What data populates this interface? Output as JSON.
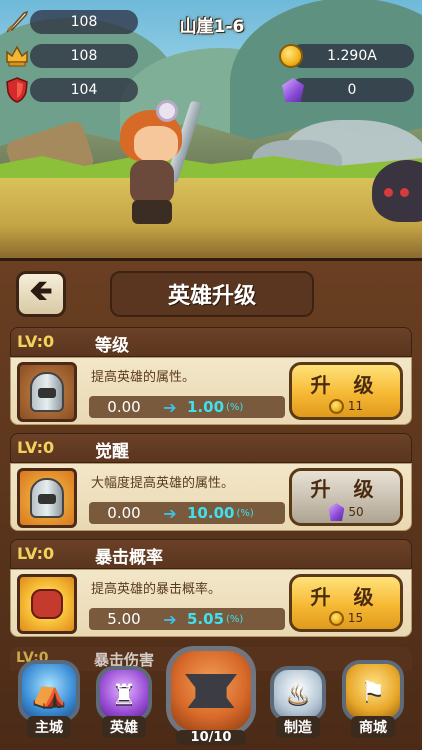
{
  "hud": {
    "stage": "山崖1-6",
    "attack": "108",
    "helmet": "108",
    "defense": "104",
    "gold": "1.290A",
    "gems": "0"
  },
  "panel": {
    "title": "英雄升级",
    "back_icon": "back-arrow-icon"
  },
  "rows": [
    {
      "lv": "LV:0",
      "title": "等级",
      "desc": "提高英雄的属性。",
      "from": "0.00",
      "to": "1.00",
      "unit": "(%)",
      "button": "升 级",
      "cost": "11",
      "currency": "gold"
    },
    {
      "lv": "LV:0",
      "title": "觉醒",
      "desc": "大幅度提高英雄的属性。",
      "from": "0.00",
      "to": "10.00",
      "unit": "(%)",
      "button": "升 级",
      "cost": "50",
      "currency": "gem"
    },
    {
      "lv": "LV:0",
      "title": "暴击概率",
      "desc": "提高英雄的暴击概率。",
      "from": "5.00",
      "to": "5.05",
      "unit": "(%)",
      "button": "升 级",
      "cost": "15",
      "currency": "gold"
    }
  ],
  "peek": {
    "lv": "LV:0",
    "title": "暴击伤害"
  },
  "nav": {
    "items": [
      {
        "label": "主城",
        "icon": "castle-tent-icon"
      },
      {
        "label": "英雄",
        "icon": "hero-icon"
      },
      {
        "label": "10/10",
        "icon": "anvil-icon"
      },
      {
        "label": "制造",
        "icon": "cauldron-icon"
      },
      {
        "label": "商城",
        "icon": "shop-icon"
      }
    ]
  },
  "colors": {
    "gold_button": "#f6b934",
    "gray_button": "#c9c0b0",
    "lv_text": "#f3d25a",
    "value_cyan": "#3fe0f0"
  }
}
